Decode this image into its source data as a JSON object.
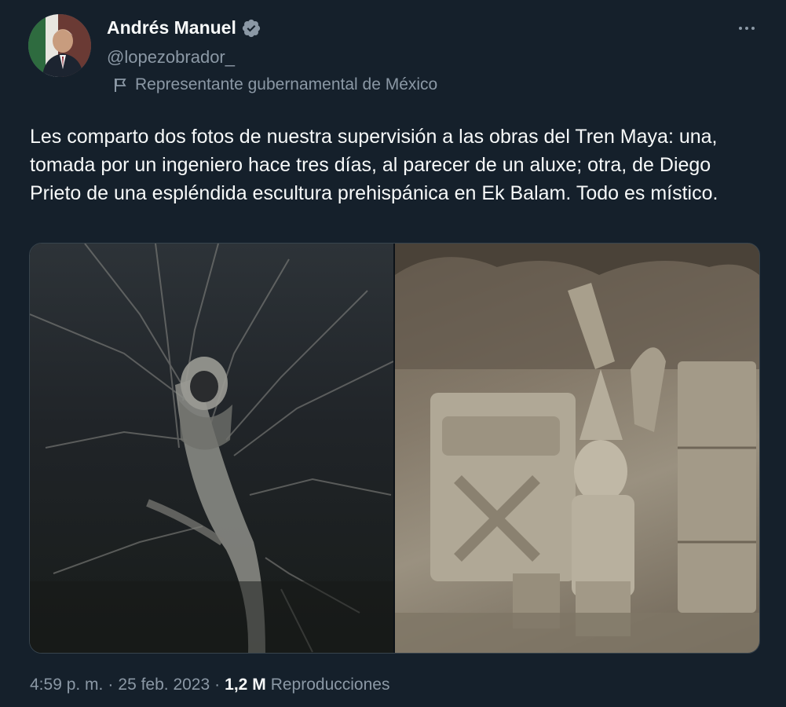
{
  "author": {
    "name": "Andrés Manuel",
    "handle": "@lopezobrador_",
    "label": "Representante gubernamental de México",
    "verified_color": "#8b98a5"
  },
  "tweet": {
    "text": "Les comparto dos fotos de nuestra supervisión a las obras del Tren Maya: una, tomada por un ingeniero hace tres días, al parecer de un aluxe; otra, de Diego Prieto de una espléndida escultura prehispánica en Ek Balam. Todo es místico."
  },
  "meta": {
    "time": "4:59 p. m.",
    "separator": "·",
    "date": "25 feb. 2023",
    "views_count": "1,2 M",
    "views_label": "Reproducciones"
  },
  "theme": {
    "background": "#15202b",
    "text": "#f7f9f9",
    "secondary": "#8b98a5"
  }
}
